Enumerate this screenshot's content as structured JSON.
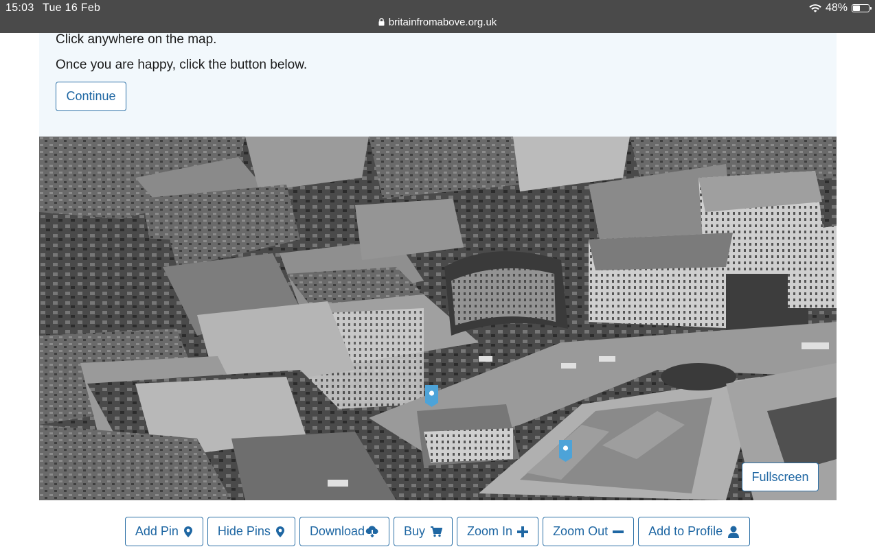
{
  "status_bar": {
    "time": "15:03",
    "date": "Tue 16 Feb",
    "url": "britainfromabove.org.uk",
    "battery": "48%",
    "battery_level": 0.48
  },
  "instructions": {
    "line1": "Click anywhere on the map.",
    "line2": "Once you are happy, click the button below.",
    "continue_label": "Continue"
  },
  "photo": {
    "fullscreen_label": "Fullscreen"
  },
  "toolbar": {
    "add_pin": "Add Pin",
    "hide_pins": "Hide Pins",
    "download": "Download",
    "buy": "Buy",
    "zoom_in": "Zoom In",
    "zoom_out": "Zoom Out",
    "add_to_profile": "Add to Profile"
  },
  "icons": {
    "add_pin": "map-marker-icon",
    "hide_pins": "map-marker-icon",
    "download": "cloud-download-icon",
    "buy": "shopping-cart-icon",
    "zoom_in": "plus-icon",
    "zoom_out": "minus-icon",
    "add_to_profile": "user-icon"
  },
  "colors": {
    "accent": "#1f67a3",
    "panel_bg": "#f2f8fc",
    "status_bar_bg": "#4a4a4a",
    "pin": "#4da3d8"
  }
}
